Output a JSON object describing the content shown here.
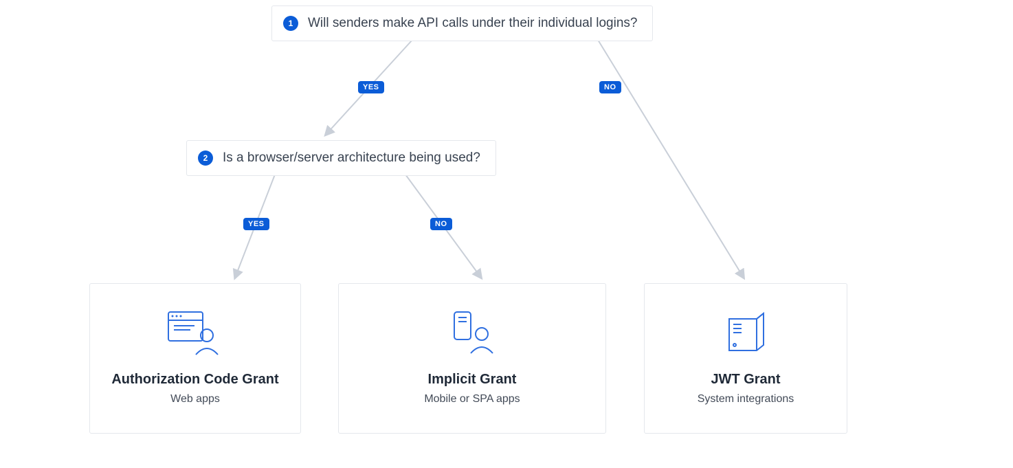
{
  "decisions": {
    "d1": {
      "num": "1",
      "text": "Will senders make API calls under their individual logins?"
    },
    "d2": {
      "num": "2",
      "text": "Is a browser/server architecture being used?"
    }
  },
  "labels": {
    "yes": "YES",
    "no": "NO"
  },
  "cards": {
    "auth": {
      "title": "Authorization Code Grant",
      "subtitle": "Web apps"
    },
    "implicit": {
      "title": "Implicit Grant",
      "subtitle": "Mobile or SPA apps"
    },
    "jwt": {
      "title": "JWT Grant",
      "subtitle": "System integrations"
    }
  },
  "colors": {
    "accent": "#0b5cd7",
    "line": "#c9cfd8",
    "text": "#384250"
  }
}
